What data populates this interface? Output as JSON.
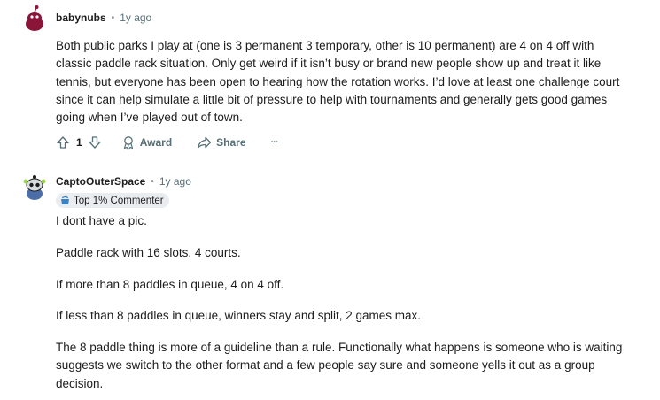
{
  "comments": [
    {
      "author": "babynubs",
      "age": "1y ago",
      "paragraphs": [
        "Both public parks I play at (one is 3 permanent 3 temporary, other is 10 permanent) are 4 on 4 off with classic paddle rack situation. Only get weird if it isn’t busy or brand new people show up and treat it like tennis, but everyone has been open to hearing how the rotation works. I’d love at least one challenge court since it can help simulate a little bit of pressure to help with tournaments and generally gets good games going when I’ve played out of town."
      ],
      "actions": {
        "vote_count": "1",
        "award_label": "Award",
        "share_label": "Share",
        "more_label": "···"
      }
    },
    {
      "author": "CaptoOuterSpace",
      "age": "1y ago",
      "badge": "Top 1% Commenter",
      "paragraphs": [
        "I dont have a pic.",
        "Paddle rack with 16 slots. 4 courts.",
        "If more than 8 paddles in queue, 4 on 4 off.",
        "If less than 8 paddles in queue, winners stay and split, 2 games max.",
        "The 8 paddle thing is more of a guideline than a rule. Functionally what happens is someone who is waiting suggests we switch to the other format and a few people say sure and someone yells it out as a group decision."
      ]
    }
  ],
  "separator": "•",
  "icons": {
    "upvote": "upvote-arrow-icon",
    "downvote": "downvote-arrow-icon",
    "award": "award-ribbon-icon",
    "share": "share-arrow-icon",
    "badge": "top-commenter-icon"
  },
  "colors": {
    "meta_text": "#576f76",
    "badge_bg": "#eaedef",
    "avatar1": "#8a1538",
    "avatar2": "#4b6ea8"
  }
}
